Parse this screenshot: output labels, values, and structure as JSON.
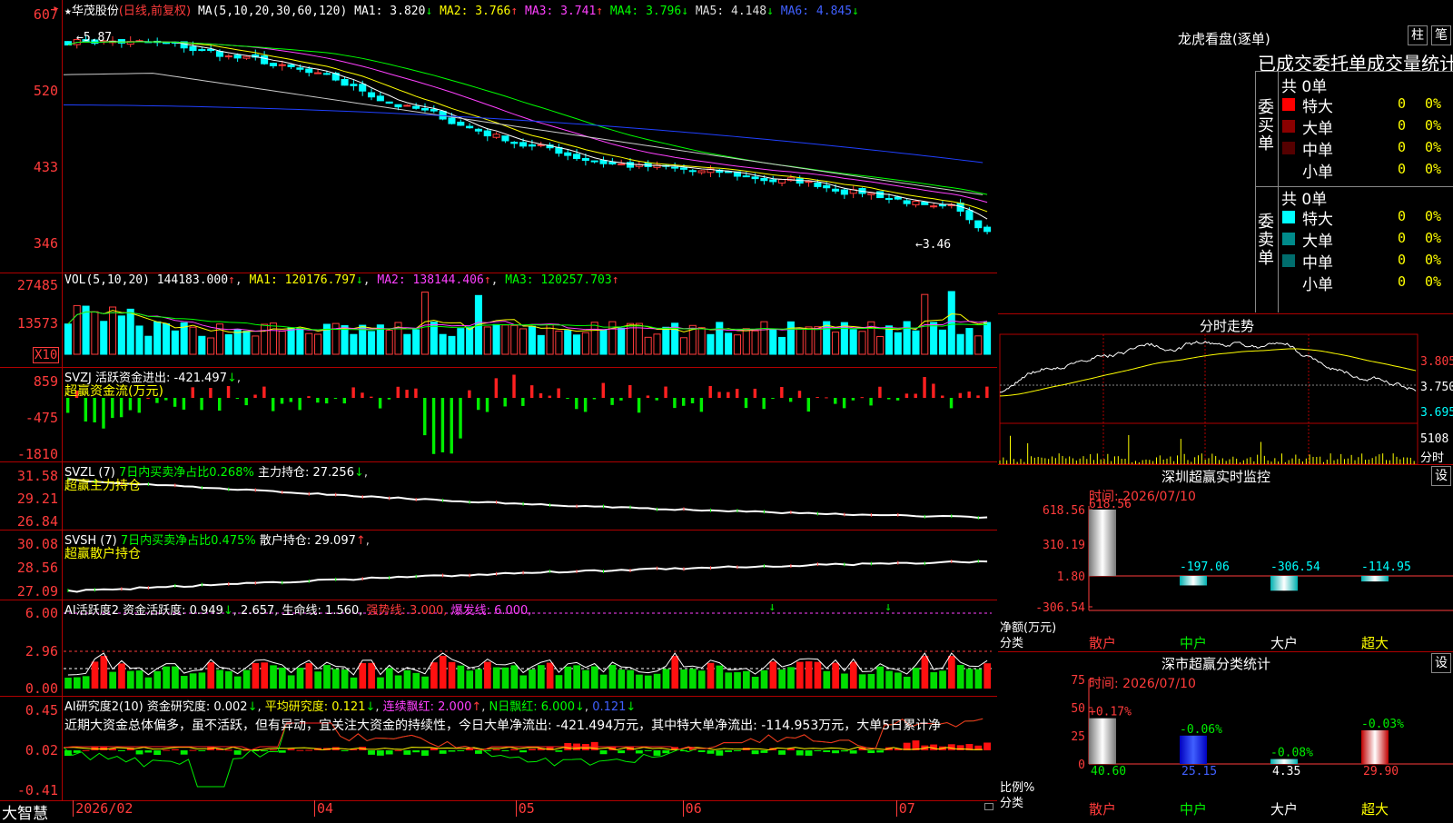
{
  "stock": {
    "name": "华茂股份",
    "mode": "(日线,前复权)",
    "ma_label": "MA(5,10,20,30,60,120)",
    "ma": [
      {
        "label": "MA1:",
        "value": "3.820",
        "arrow": "↓",
        "color": "#ffffff"
      },
      {
        "label": "MA2:",
        "value": "3.766",
        "arrow": "↑",
        "color": "#ffff00"
      },
      {
        "label": "MA3:",
        "value": "3.741",
        "arrow": "↑",
        "color": "#ff40ff"
      },
      {
        "label": "MA4:",
        "value": "3.796",
        "arrow": "↓",
        "color": "#00ff00"
      },
      {
        "label": "MA5:",
        "value": "4.148",
        "arrow": "↓",
        "color": "#dddddd"
      },
      {
        "label": "MA6:",
        "value": "4.845",
        "arrow": "↓",
        "color": "#4060ff"
      }
    ],
    "yticks": [
      "607",
      "520",
      "433",
      "346"
    ],
    "high_mark": "5.87",
    "low_mark": "3.46"
  },
  "vol": {
    "label": "VOL(5,10,20)",
    "value": "144183.000",
    "ma1": "MA1: 120176.797",
    "ma2": "MA2: 138144.406",
    "ma3": "MA3: 120257.703",
    "yticks": [
      "27485",
      "13573"
    ],
    "unit": "X10"
  },
  "svzj": {
    "line1": "SVZJ  活跃资金进出: -421.497",
    "arrow": "↓",
    "line2": "超赢资金流(万元)",
    "yticks": [
      "859",
      "-475",
      "-1810"
    ]
  },
  "svzl": {
    "name": "SVZL (7)",
    "desc": "7日内买卖净占比0.268%",
    "hold": "主力持仓: 27.256",
    "arrow": "↓",
    "line2": "超赢主力持仓",
    "yticks": [
      "31.58",
      "29.21",
      "26.84"
    ]
  },
  "svsh": {
    "name": "SVSH (7)",
    "desc": "7日内买卖净占比0.475%",
    "hold": "散户持仓: 29.097",
    "arrow": "↑",
    "line2": "超赢散户持仓",
    "yticks": [
      "30.08",
      "28.56",
      "27.09"
    ]
  },
  "ai_act": {
    "name": "AI活跃度2",
    "text": "资金活跃度: 0.949",
    "a1": "↓",
    "v2": "2.657",
    "life": "生命线: 1.560,",
    "strong": "强势线: 3.000,",
    "burst": "爆发线: 6.000,",
    "yticks": [
      "6.00",
      "2.96",
      "0.00"
    ]
  },
  "ai_res": {
    "name": "AI研究度2(10)",
    "t1": "资金研究度: 0.002",
    "t2": "平均研究度: 0.121",
    "t3": "连续飘红: 2.000",
    "t4": "N日飘红: 6.000",
    "t5": "0.121",
    "comment": "近期大资金总体偏多，虽不活跃，但有异动，宜关注大资金的持续性，今日大单净流出: -421.494万元，其中特大单净流出: -114.953万元，大单5日累计净",
    "yticks": [
      "0.45",
      "0.02",
      "-0.41"
    ]
  },
  "xaxis": {
    "brand": "大智慧",
    "labels": [
      {
        "text": "2026/02",
        "pos": 0.01
      },
      {
        "text": "04",
        "pos": 0.27
      },
      {
        "text": "05",
        "pos": 0.487
      },
      {
        "text": "06",
        "pos": 0.667
      },
      {
        "text": "07",
        "pos": 0.897
      }
    ]
  },
  "lhb": {
    "title": "龙虎看盘(逐单)",
    "btn1": "柱",
    "btn2": "笔",
    "subtitle": "已成交委托单成交量统计",
    "buy_total": "共 0单",
    "sell_total": "共 0单",
    "buy_label": "委买单",
    "sell_label": "委卖单",
    "buy_rows": [
      {
        "label": "特大",
        "count": "0",
        "pct": "0%",
        "color": "#ff0000"
      },
      {
        "label": "大单",
        "count": "0",
        "pct": "0%",
        "color": "#8b0000"
      },
      {
        "label": "中单",
        "count": "0",
        "pct": "0%",
        "color": "#550000"
      },
      {
        "label": "小单",
        "count": "0",
        "pct": "0%",
        "color": ""
      }
    ],
    "sell_rows": [
      {
        "label": "特大",
        "count": "0",
        "pct": "0%",
        "color": "#00ffff"
      },
      {
        "label": "大单",
        "count": "0",
        "pct": "0%",
        "color": "#008b8b"
      },
      {
        "label": "中单",
        "count": "0",
        "pct": "0%",
        "color": "#006d6d"
      },
      {
        "label": "小单",
        "count": "0",
        "pct": "0%",
        "color": ""
      }
    ]
  },
  "fenshi": {
    "title": "分时走势",
    "prices": [
      "3.805",
      "3.750",
      "3.695"
    ],
    "vol": "5108",
    "vol_label": "分时"
  },
  "monitor": {
    "title": "深圳超赢实时监控",
    "btn": "设",
    "time": "时间: 2026/07/10",
    "yticks": [
      "618.56",
      "310.19",
      "1.80",
      "-306.54"
    ],
    "ylabel": "净额(万元)",
    "xlabel": "分类",
    "bars": [
      {
        "label": "散户",
        "value": 618.56,
        "text": "618.56",
        "kind": "gray"
      },
      {
        "label": "中户",
        "value": -197.06,
        "text": "-197.06",
        "kind": "cyan"
      },
      {
        "label": "大户",
        "value": -306.54,
        "text": "-306.54",
        "kind": "cyan"
      },
      {
        "label": "超大",
        "value": -114.95,
        "text": "-114.95",
        "kind": "cyan"
      }
    ]
  },
  "classify": {
    "title": "深市超赢分类统计",
    "btn": "设",
    "time": "时间: 2026/07/10",
    "yticks": [
      "75",
      "50",
      "25",
      "0"
    ],
    "ylabel": "比例%",
    "xlabel": "分类",
    "bars": [
      {
        "label": "散户",
        "value": 40.6,
        "text": "40.60",
        "delta": "+0.17%",
        "kind": "gray"
      },
      {
        "label": "中户",
        "value": 25.15,
        "text": "25.15",
        "delta": "-0.06%",
        "kind": "blue"
      },
      {
        "label": "大户",
        "value": 4.35,
        "text": "4.35",
        "delta": "-0.08%",
        "kind": "cyan"
      },
      {
        "label": "超大",
        "value": 29.9,
        "text": "29.90",
        "delta": "-0.03%",
        "kind": "red"
      }
    ]
  }
}
